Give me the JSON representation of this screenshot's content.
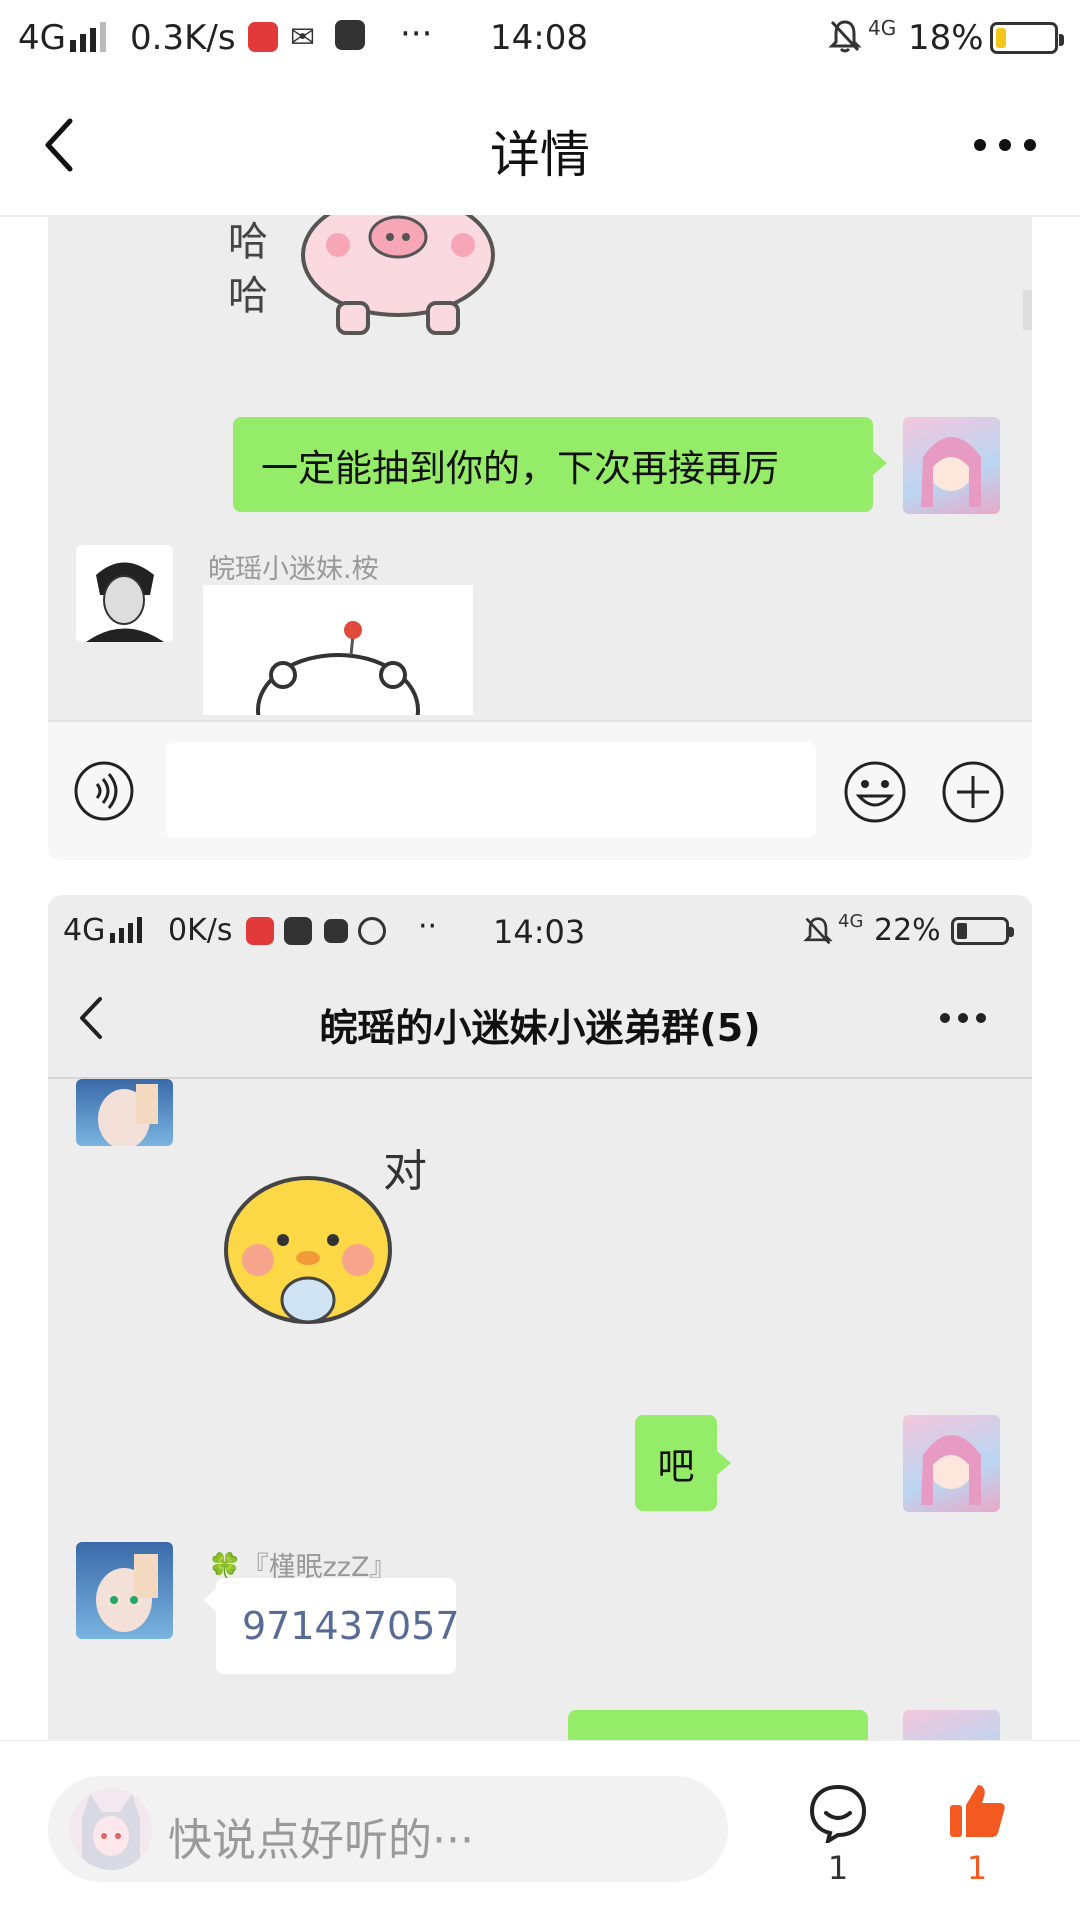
{
  "status_top": {
    "network": "4G",
    "speed": "0.3K/s",
    "time": "14:08",
    "net_right": "4G",
    "battery": "18%",
    "battery_level": 0.18,
    "dots": "···"
  },
  "nav": {
    "title": "详情",
    "back_icon": "chevron-left-icon",
    "more_icon": "more-icon"
  },
  "screenshot1": {
    "sticker_text": "哈哈",
    "bubble_me": "一定能抽到你的，下次再接再厉",
    "sender_name": "皖瑶小迷妹.桉"
  },
  "screenshot2": {
    "status": {
      "network": "4G",
      "speed": "0K/s",
      "time": "14:03",
      "net_right": "4G",
      "battery": "22%",
      "battery_level": 0.22,
      "dots": "··"
    },
    "title": "皖瑶的小迷妹小迷弟群(5)",
    "sticker_text": "对",
    "bubble_me": "吧",
    "sender_name": "🍀『槿眠zzZ』",
    "message": "971437057"
  },
  "bottom": {
    "comment_placeholder": "快说点好听的···",
    "comment_count": "1",
    "like_count": "1"
  },
  "colors": {
    "wechat_green": "#95ec69",
    "panel_bg": "#ededed",
    "like_orange": "#f25a22",
    "link_blue": "#576b95"
  }
}
